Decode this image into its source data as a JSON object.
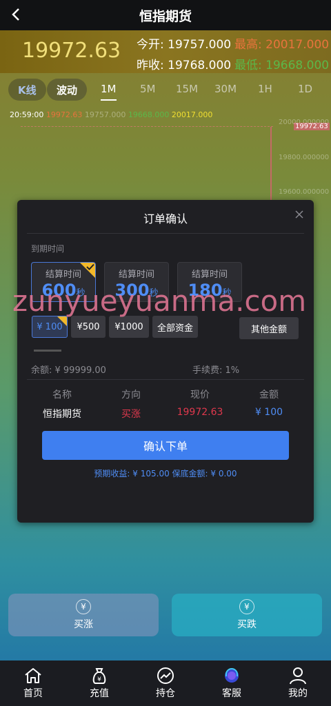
{
  "header": {
    "title": "恒指期货",
    "back_icon": "chevron-left-icon"
  },
  "quote": {
    "price": "19972.63",
    "open_label": "今开:",
    "open_value": "19757.000",
    "high_label": "最高:",
    "high_value": "20017.000",
    "prev_close_label": "昨收:",
    "prev_close_value": "19768.000",
    "low_label": "最低:",
    "low_value": "19668.000"
  },
  "chart_tabs": [
    "K线",
    "波动",
    "1M",
    "5M",
    "15M",
    "30M",
    "1H",
    "1D"
  ],
  "info_line": {
    "time": "20:59:00",
    "v1": "19972.63",
    "v2": "19757.000",
    "v3": "19668.000",
    "v4": "20017.000"
  },
  "y_axis": [
    "20000.000000",
    "19800.000000",
    "19600.000000"
  ],
  "current_price_tag": "19972.63",
  "modal": {
    "title": "订单确认",
    "expire_label": "到期时间",
    "time_options": [
      {
        "label": "结算时间",
        "value": "600",
        "unit": "秒"
      },
      {
        "label": "结算时间",
        "value": "300",
        "unit": "秒"
      },
      {
        "label": "结算时间",
        "value": "180",
        "unit": "秒"
      }
    ],
    "amount_options": [
      "¥ 100",
      "¥500",
      "¥1000",
      "全部资金"
    ],
    "other_amount": "其他金额",
    "balance": "余额: ¥ 99999.00",
    "fee": "手续费: 1%",
    "headers": [
      "名称",
      "方向",
      "现价",
      "金额"
    ],
    "row": {
      "name": "恒指期货",
      "direction": "买涨",
      "price": "19972.63",
      "amount": "¥ 100"
    },
    "confirm_label": "确认下单",
    "expected": "预期收益: ¥ 105.00   保底金额: ¥ 0.00"
  },
  "watermark": "zunyueyuanma.com",
  "trade": {
    "buy_up": "买涨",
    "buy_down": "买跌"
  },
  "nav": [
    "首页",
    "充值",
    "持仓",
    "客服",
    "我的"
  ],
  "colors": {
    "accent": "#3f7ff0",
    "up": "#e0384d",
    "down": "#5bb84a",
    "highlight": "#e8733d",
    "gold": "#f1df7a"
  }
}
